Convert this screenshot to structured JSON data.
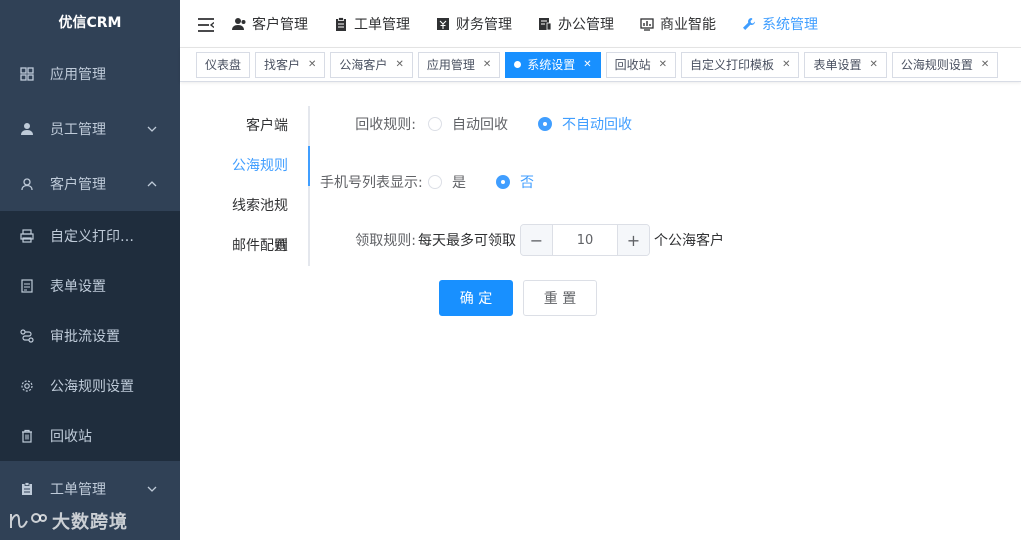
{
  "app": {
    "title": "优信CRM"
  },
  "sidebar": {
    "items": [
      {
        "label": "应用管理",
        "icon": "grid-icon"
      },
      {
        "label": "员工管理",
        "icon": "user-icon",
        "arrow": "down"
      },
      {
        "label": "客户管理",
        "icon": "customer-icon",
        "arrow": "up"
      }
    ],
    "subitems": [
      {
        "label": "自定义打印…",
        "icon": "printer-icon"
      },
      {
        "label": "表单设置",
        "icon": "form-icon"
      },
      {
        "label": "审批流设置",
        "icon": "flow-icon"
      },
      {
        "label": "公海规则设置",
        "icon": "gear-icon"
      },
      {
        "label": "回收站",
        "icon": "trash-icon"
      }
    ],
    "bottom_items": [
      {
        "label": "工单管理",
        "icon": "clipboard-icon",
        "arrow": "down"
      }
    ]
  },
  "topnav": {
    "items": [
      {
        "label": "客户管理",
        "icon": "user-icon"
      },
      {
        "label": "工单管理",
        "icon": "clipboard-icon"
      },
      {
        "label": "财务管理",
        "icon": "finance-icon"
      },
      {
        "label": "办公管理",
        "icon": "office-icon"
      },
      {
        "label": "商业智能",
        "icon": "chart-icon"
      },
      {
        "label": "系统管理",
        "icon": "wrench-icon",
        "active": true
      }
    ]
  },
  "tags": [
    {
      "label": "仪表盘",
      "closable": false
    },
    {
      "label": "找客户",
      "closable": true
    },
    {
      "label": "公海客户",
      "closable": true
    },
    {
      "label": "应用管理",
      "closable": true
    },
    {
      "label": "系统设置",
      "closable": true,
      "active": true
    },
    {
      "label": "回收站",
      "closable": true
    },
    {
      "label": "自定义打印模板",
      "closable": true
    },
    {
      "label": "表单设置",
      "closable": true
    },
    {
      "label": "公海规则设置",
      "closable": true
    }
  ],
  "vtabs": [
    {
      "label": "客户端"
    },
    {
      "label": "公海规则",
      "active": true
    },
    {
      "label": "线索池规则"
    },
    {
      "label": "邮件配置"
    }
  ],
  "form": {
    "recycle_label": "回收规则:",
    "recycle_auto": "自动回收",
    "recycle_manual": "不自动回收",
    "recycle_selected": "manual",
    "phone_label": "手机号列表显示:",
    "phone_yes": "是",
    "phone_no": "否",
    "phone_selected": "no",
    "claim_label": "领取规则:",
    "claim_prefix": "每天最多可领取",
    "claim_value": "10",
    "claim_suffix": "个公海客户",
    "minus": "−",
    "plus": "+",
    "confirm": "确 定",
    "reset": "重 置"
  },
  "watermark": {
    "text": "大数跨境"
  },
  "colors": {
    "sidebar_bg": "#304156",
    "submenu_bg": "#1f2d3d",
    "accent": "#409eff",
    "primary": "#1890ff"
  }
}
